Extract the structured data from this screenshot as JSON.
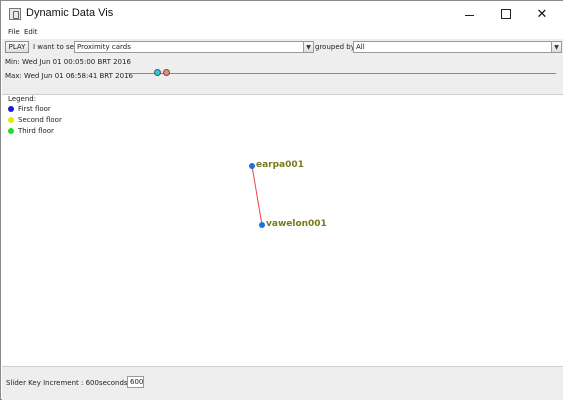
{
  "window": {
    "title": "Dynamic Data Vis"
  },
  "menu": [
    {
      "label": "File"
    },
    {
      "label": "Edit"
    }
  ],
  "controls": {
    "play_label": "PLAY",
    "want_label": "I want to see:",
    "want_value": "Proximity cards",
    "grouped_label": "grouped by:",
    "grouped_value": "All",
    "min_label": "Min: Wed Jun 01 00:05:00 BRT 2016",
    "max_label": "Max: Wed Jun 01 06:58:41 BRT 2016",
    "slider_colors": {
      "min_knob": "#28c8e0",
      "max_knob": "#f08a6a"
    }
  },
  "legend": {
    "title": "Legend:",
    "items": [
      {
        "label": "First floor",
        "color": "#1a1ad8"
      },
      {
        "label": "Second floor",
        "color": "#e8e800"
      },
      {
        "label": "Third floor",
        "color": "#22dd22"
      }
    ]
  },
  "graph": {
    "nodes": [
      {
        "label": "earpa001"
      },
      {
        "label": "vawelon001"
      }
    ],
    "edge_color": "#ee4444",
    "node_color": "#1e6fe0",
    "label_color": "#7a7a1a"
  },
  "bottom": {
    "increment_label": "Slider Key Increment : 600seconds",
    "increment_value": "600"
  }
}
